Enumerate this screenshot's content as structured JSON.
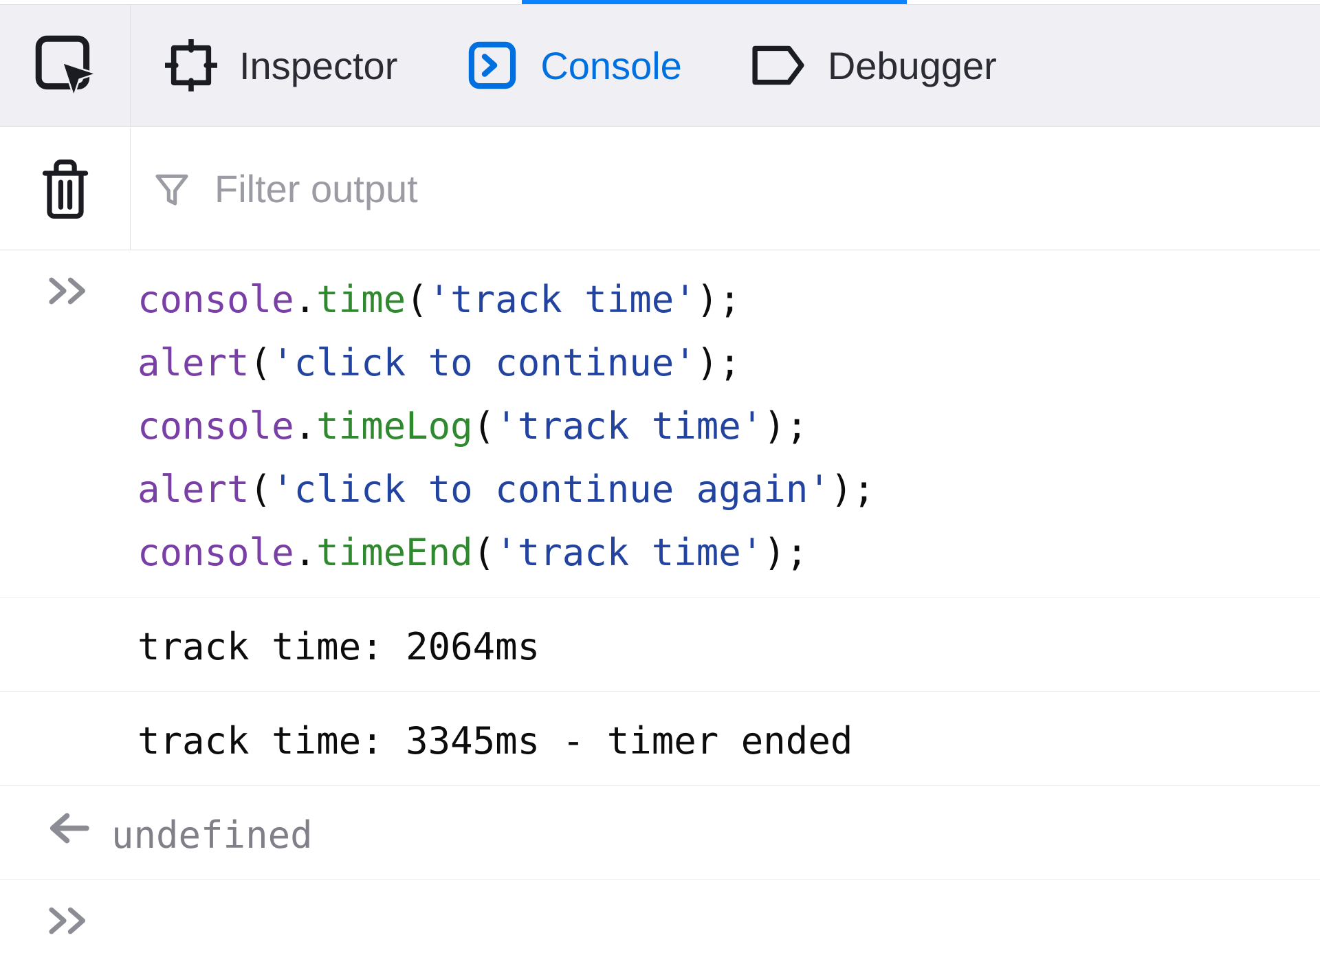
{
  "tabs": {
    "inspector": "Inspector",
    "console": "Console",
    "debugger": "Debugger"
  },
  "filter": {
    "placeholder": "Filter output"
  },
  "code": {
    "line1": {
      "obj": "console",
      "dot": ".",
      "method": "time",
      "open": "(",
      "str": "'track time'",
      "close": ");"
    },
    "line2": {
      "obj": "alert",
      "open": "(",
      "str": "'click to continue'",
      "close": ");"
    },
    "line3": {
      "obj": "console",
      "dot": ".",
      "method": "timeLog",
      "open": "(",
      "str": "'track time'",
      "close": ");"
    },
    "line4": {
      "obj": "alert",
      "open": "(",
      "str": "'click to continue again'",
      "close": ");"
    },
    "line5": {
      "obj": "console",
      "dot": ".",
      "method": "timeEnd",
      "open": "(",
      "str": "'track time'",
      "close": ");"
    }
  },
  "output": {
    "log1": "track time: 2064ms",
    "log2": "track time: 3345ms - timer ended",
    "result": "undefined"
  }
}
